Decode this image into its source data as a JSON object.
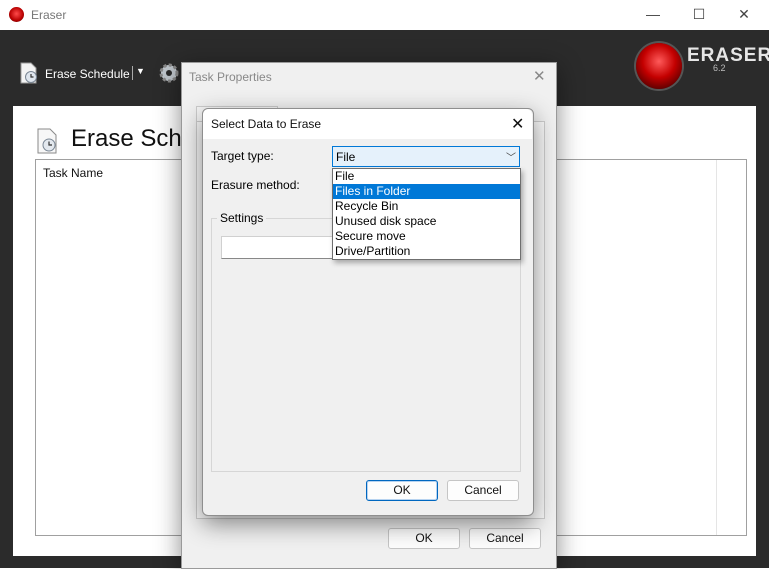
{
  "window": {
    "title": "Eraser"
  },
  "window_controls": {
    "minimize": "—",
    "maximize": "☐",
    "close": "✕"
  },
  "toolbar": {
    "erase_schedule_label": "Erase Schedule",
    "dropdown_arrow": "▼"
  },
  "logo": {
    "text": "ERASER",
    "version": "6.2"
  },
  "main": {
    "page_title": "Erase Sche",
    "columns": [
      "Task Name"
    ]
  },
  "task_properties_dialog": {
    "title": "Task Properties",
    "close": "✕",
    "ok_label": "OK",
    "cancel_label": "Cancel"
  },
  "select_data_dialog": {
    "title": "Select Data to Erase",
    "close": "✕",
    "target_type_label": "Target type:",
    "erasure_method_label": "Erasure method:",
    "settings_label": "Settings",
    "target_type_value": "File",
    "target_type_options": [
      "File",
      "Files in Folder",
      "Recycle Bin",
      "Unused disk space",
      "Secure move",
      "Drive/Partition"
    ],
    "highlighted_option": "Files in Folder",
    "combo_arrow": "﹀",
    "ok_label": "OK",
    "cancel_label": "Cancel"
  },
  "colors": {
    "toolbar_bg": "#2b2b2b",
    "accent": "#0078d7",
    "logo_red": "#c40000"
  }
}
